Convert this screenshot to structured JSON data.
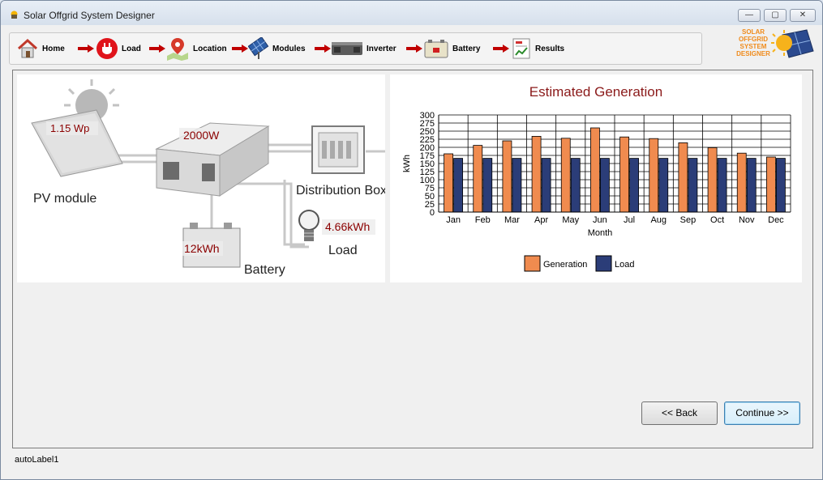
{
  "window": {
    "title": "Solar Offgrid System Designer",
    "minimize_symbol": "—",
    "maximize_symbol": "▢",
    "close_symbol": "✕"
  },
  "toolbar": {
    "items": [
      {
        "label": "Home",
        "icon": "home-icon"
      },
      {
        "label": "Load",
        "icon": "plug-icon"
      },
      {
        "label": "Location",
        "icon": "map-pin-icon"
      },
      {
        "label": "Modules",
        "icon": "solar-panel-icon"
      },
      {
        "label": "Inverter",
        "icon": "inverter-icon"
      },
      {
        "label": "Battery",
        "icon": "battery-icon"
      },
      {
        "label": "Results",
        "icon": "results-icon"
      }
    ]
  },
  "logo": {
    "lines": [
      "SOLAR",
      "OFFGRID",
      "SYSTEM",
      "DESIGNER"
    ]
  },
  "diagram": {
    "pv_value": "1.15 Wp",
    "pv_label": "PV module",
    "inverter_value": "2000W",
    "distribution_label": "Distribution Box",
    "battery_value": "12kWh",
    "battery_label": "Battery",
    "load_value": "4.66kWh",
    "load_label": "Load"
  },
  "chart_data": {
    "type": "bar",
    "title": "Estimated Generation",
    "xlabel": "Month",
    "ylabel": "kWh",
    "ylim": [
      0,
      300
    ],
    "yticks": [
      0,
      25,
      50,
      75,
      100,
      125,
      150,
      175,
      200,
      225,
      250,
      275,
      300
    ],
    "grid": true,
    "legend": "bottom",
    "categories": [
      "Jan",
      "Feb",
      "Mar",
      "Apr",
      "May",
      "Jun",
      "Jul",
      "Aug",
      "Sep",
      "Oct",
      "Nov",
      "Dec"
    ],
    "series": [
      {
        "name": "Generation",
        "color": "#f08b4f",
        "values": [
          180,
          206,
          220,
          234,
          228,
          260,
          232,
          227,
          214,
          199,
          182,
          170
        ]
      },
      {
        "name": "Load",
        "color": "#2b3d78",
        "values": [
          166,
          166,
          166,
          166,
          166,
          166,
          166,
          166,
          166,
          166,
          166,
          166
        ]
      }
    ]
  },
  "buttons": {
    "back": "<< Back",
    "continue": "Continue >>"
  },
  "status": {
    "label": "autoLabel1"
  }
}
